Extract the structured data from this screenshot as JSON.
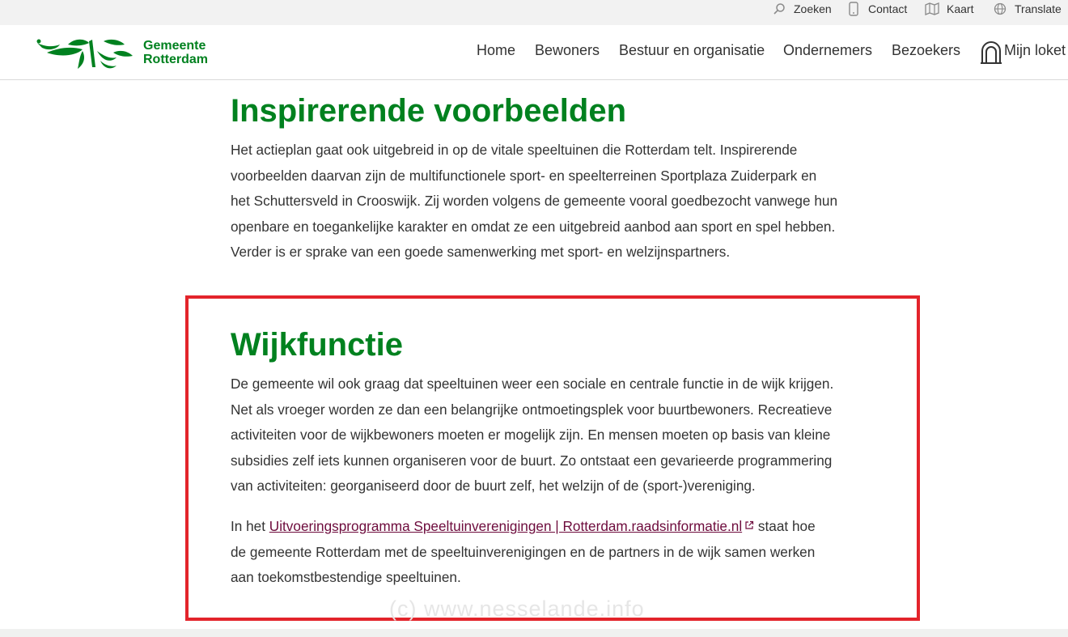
{
  "utility": {
    "search_label": "Zoeken",
    "contact_label": "Contact",
    "map_label": "Kaart",
    "translate_label": "Translate",
    "icons": [
      "search-icon",
      "phone-icon",
      "map-icon",
      "globe-icon"
    ]
  },
  "logo": {
    "line1": "Gemeente",
    "line2": "Rotterdam",
    "color": "#00811f"
  },
  "nav": {
    "items": [
      "Home",
      "Bewoners",
      "Bestuur en organisatie",
      "Ondernemers",
      "Bezoekers"
    ],
    "mijn_loket": "Mijn loket",
    "mijn_loket_icon": "arch-icon"
  },
  "section1": {
    "heading": "Inspirerende voorbeelden",
    "lines": [
      "Het actieplan gaat ook uitgebreid in op de vitale speeltuinen die Rotterdam telt. Inspirerende",
      "voorbeelden daarvan zijn de multifunctionele sport- en speelterreinen Sportplaza Zuiderpark en",
      "het Schuttersveld in Crooswijk. Zij worden volgens de gemeente vooral goedbezocht vanwege hun",
      "openbare en toegankelijke karakter en omdat ze een uitgebreid aanbod aan  sport en spel hebben.",
      "Verder is er sprake van een goede samenwerking met sport- en welzijnspartners."
    ]
  },
  "section2": {
    "heading": "Wijkfunctie",
    "lines": [
      "De gemeente wil ook graag dat speeltuinen weer een sociale en centrale functie in de wijk krijgen.",
      "Net als vroeger worden ze dan een belangrijke ontmoetingsplek voor buurtbewoners. Recreatieve",
      "activiteiten voor de wijkbewoners moeten er mogelijk zijn. En mensen moeten op basis van kleine",
      "subsidies zelf iets kunnen organiseren voor de buurt. Zo ontstaat een gevarieerde programmering",
      "van activiteiten: georganiseerd door de buurt zelf, het welzijn of de (sport-)vereniging."
    ],
    "para2_prefix": "In het ",
    "link_text": "Uitvoeringsprogramma Speeltuinverenigingen | Rotterdam.raadsinformatie.nl",
    "link_icon": "external-link-icon",
    "para2_suffix": " staat hoe",
    "para2_lines": [
      "de gemeente Rotterdam met de speeltuinverenigingen en de partners in de wijk samen werken",
      "aan toekomstbestendige speeltuinen."
    ]
  },
  "watermark": "(c)  www.nesselande.info",
  "colors": {
    "heading_green": "#00811f",
    "link": "#6d0b3c",
    "highlight_border": "#e3242b"
  }
}
